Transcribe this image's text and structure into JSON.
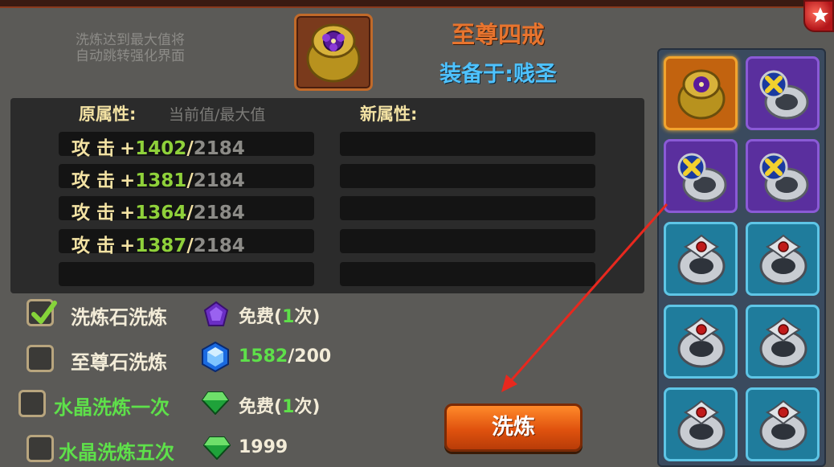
{
  "hint": {
    "line1": "洗炼达到最大值将",
    "line2": "自动跳转强化界面"
  },
  "item": {
    "name": "至尊四戒",
    "equipped_on": "装备于:贱圣",
    "icon": "gold-ring-icon"
  },
  "stats": {
    "original_label": "原属性:",
    "current_max_label": "当前值/最大值",
    "new_label": "新属性:",
    "rows": [
      {
        "name": "攻 击",
        "plus": "+",
        "current": "1402",
        "sep": "/",
        "max": "2184"
      },
      {
        "name": "攻 击",
        "plus": "+",
        "current": "1381",
        "sep": "/",
        "max": "2184"
      },
      {
        "name": "攻 击",
        "plus": "+",
        "current": "1364",
        "sep": "/",
        "max": "2184"
      },
      {
        "name": "攻 击",
        "plus": "+",
        "current": "1387",
        "sep": "/",
        "max": "2184"
      }
    ]
  },
  "options": [
    {
      "label": "洗炼石洗炼",
      "checked": true,
      "cost_prefix": "免费(",
      "cost_num": "1",
      "cost_suffix": "次)",
      "gem": "purple-gem-icon"
    },
    {
      "label": "至尊石洗炼",
      "checked": false,
      "cost_num": "1582",
      "cost_suffix": "/200",
      "gem": "blue-crystal-icon"
    },
    {
      "label": "水晶洗炼一次",
      "checked": false,
      "cost_prefix": "免费(",
      "cost_num": "1",
      "cost_suffix": "次)",
      "gem": "green-crystal-icon"
    },
    {
      "label": "水晶洗炼五次",
      "checked": false,
      "cost_num": "1999",
      "gem": "green-crystal-icon"
    }
  ],
  "wash_button": "洗炼",
  "inventory": [
    {
      "type": "gold-ring-icon",
      "frame": "orange",
      "selected": true
    },
    {
      "type": "silver-cross-ring-icon",
      "frame": "purple"
    },
    {
      "type": "silver-cross-ring-icon",
      "frame": "purple"
    },
    {
      "type": "silver-cross-ring-icon",
      "frame": "purple"
    },
    {
      "type": "ruby-ring-icon",
      "frame": "blue"
    },
    {
      "type": "ruby-ring-icon",
      "frame": "blue"
    },
    {
      "type": "ruby-ring-icon",
      "frame": "blue"
    },
    {
      "type": "ruby-ring-icon",
      "frame": "blue"
    },
    {
      "type": "ruby-ring-icon",
      "frame": "blue"
    },
    {
      "type": "ruby-ring-icon",
      "frame": "blue"
    }
  ],
  "colors": {
    "accent_orange": "#e8742e",
    "equip_blue": "#4ec2ff",
    "value_green": "#8fd13a",
    "crystal_green": "#5ee04a"
  }
}
